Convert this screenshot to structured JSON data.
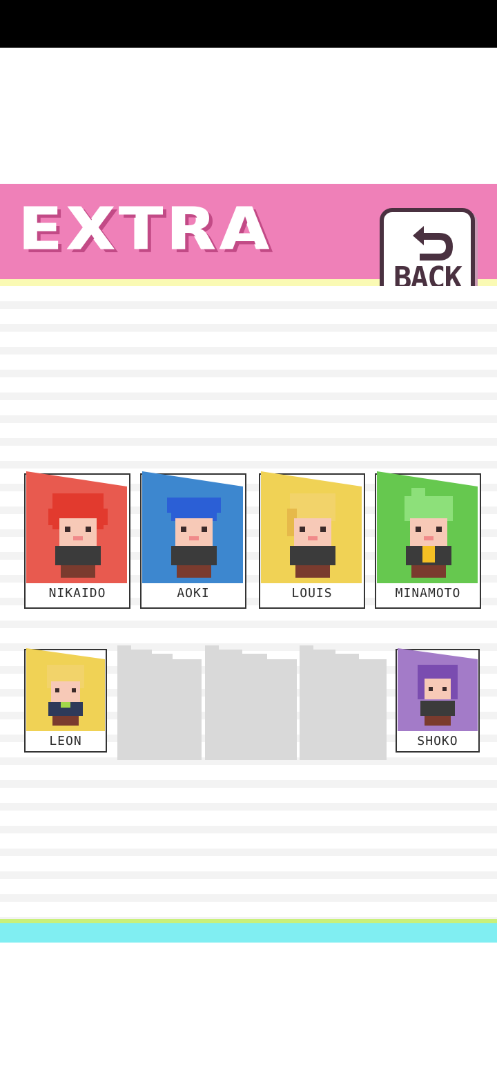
{
  "header": {
    "title": "EXTRA",
    "back_label": "BACK"
  },
  "characters_row1": [
    {
      "name": "NIKAIDO",
      "color": "#e85a4f",
      "hair": "#e23a2e"
    },
    {
      "name": "AOKI",
      "color": "#3d87cf",
      "hair": "#2b5fd6"
    },
    {
      "name": "LOUIS",
      "color": "#f0d255",
      "hair": "#f2d36a"
    },
    {
      "name": "MINAMOTO",
      "color": "#66c84f",
      "hair": "#8de07a"
    }
  ],
  "characters_row2": [
    {
      "name": "LEON",
      "color": "#f0d255",
      "hair": "#f2d36a"
    },
    {
      "name": "SHOKO",
      "color": "#a37bc8",
      "hair": "#7a4cb0"
    }
  ],
  "locked_slots": 3
}
